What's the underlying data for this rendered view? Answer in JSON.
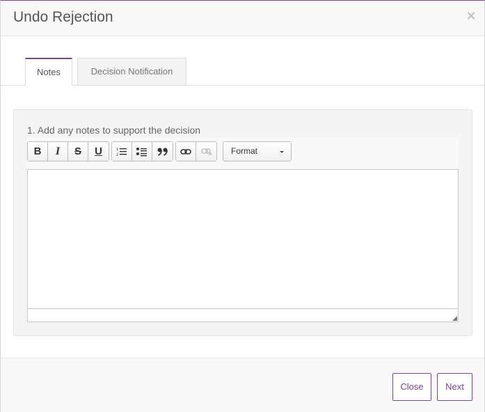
{
  "dialog": {
    "title": "Undo Rejection",
    "close_icon": "close-icon",
    "close_glyph": "×"
  },
  "tabs": [
    {
      "label": "Notes",
      "active": true
    },
    {
      "label": "Decision Notification",
      "active": false
    }
  ],
  "form": {
    "notes_label": "1. Add any notes to support the decision",
    "editor_value": ""
  },
  "toolbar": {
    "bold": {
      "glyph": "B",
      "icon": "bold-icon"
    },
    "italic": {
      "glyph": "I",
      "icon": "italic-icon"
    },
    "strike": {
      "glyph": "S",
      "icon": "strikethrough-icon"
    },
    "underline": {
      "glyph": "U",
      "icon": "underline-icon"
    },
    "numbered_list": {
      "icon": "numbered-list-icon"
    },
    "bulleted_list": {
      "icon": "bulleted-list-icon"
    },
    "blockquote": {
      "icon": "blockquote-icon"
    },
    "link": {
      "icon": "link-icon"
    },
    "unlink": {
      "icon": "unlink-icon",
      "disabled": true
    },
    "format_select": {
      "value": "Format"
    }
  },
  "footer": {
    "close_label": "Close",
    "next_label": "Next"
  },
  "colors": {
    "accent": "#7b4397",
    "panel_bg": "#f4f4f4",
    "header_bg": "#f8f8f8"
  }
}
